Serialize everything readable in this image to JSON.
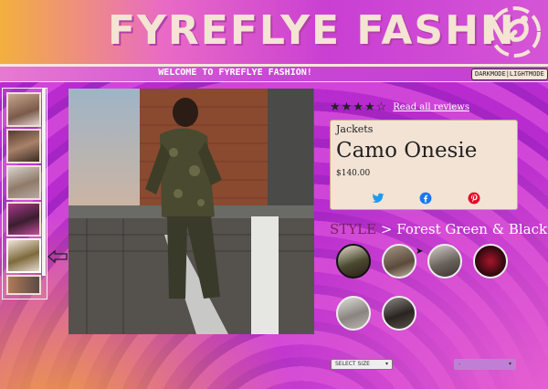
{
  "header": {
    "title": "FYREFLYE FASHN"
  },
  "welcome_bar": {
    "text": "WELCOME TO FYREFLYE FASHION!",
    "mode_toggle": "DARKMODE|LIGHTMODE"
  },
  "gallery": {
    "thumbnails": [
      "thumb-1",
      "thumb-2",
      "thumb-3",
      "thumb-4",
      "thumb-5",
      "thumb-6"
    ],
    "selected_index": 4
  },
  "product": {
    "rating": 4,
    "rating_max": 5,
    "reviews_link": "Read all reviews",
    "category": "Jackets",
    "name": "Camo Onesie",
    "price": "$140.00",
    "share_icons": [
      "twitter-icon",
      "facebook-icon",
      "pinterest-icon"
    ]
  },
  "style": {
    "label": "STYLE",
    "separator": ">",
    "selected": "Forest Green & Black",
    "swatch_count": 6
  },
  "selectors": {
    "size_placeholder": "SELECT SIZE",
    "second_placeholder": "-"
  },
  "colors": {
    "accent": "#c43acf",
    "card": "#f2e3d5",
    "title": "#f4e4d3"
  }
}
